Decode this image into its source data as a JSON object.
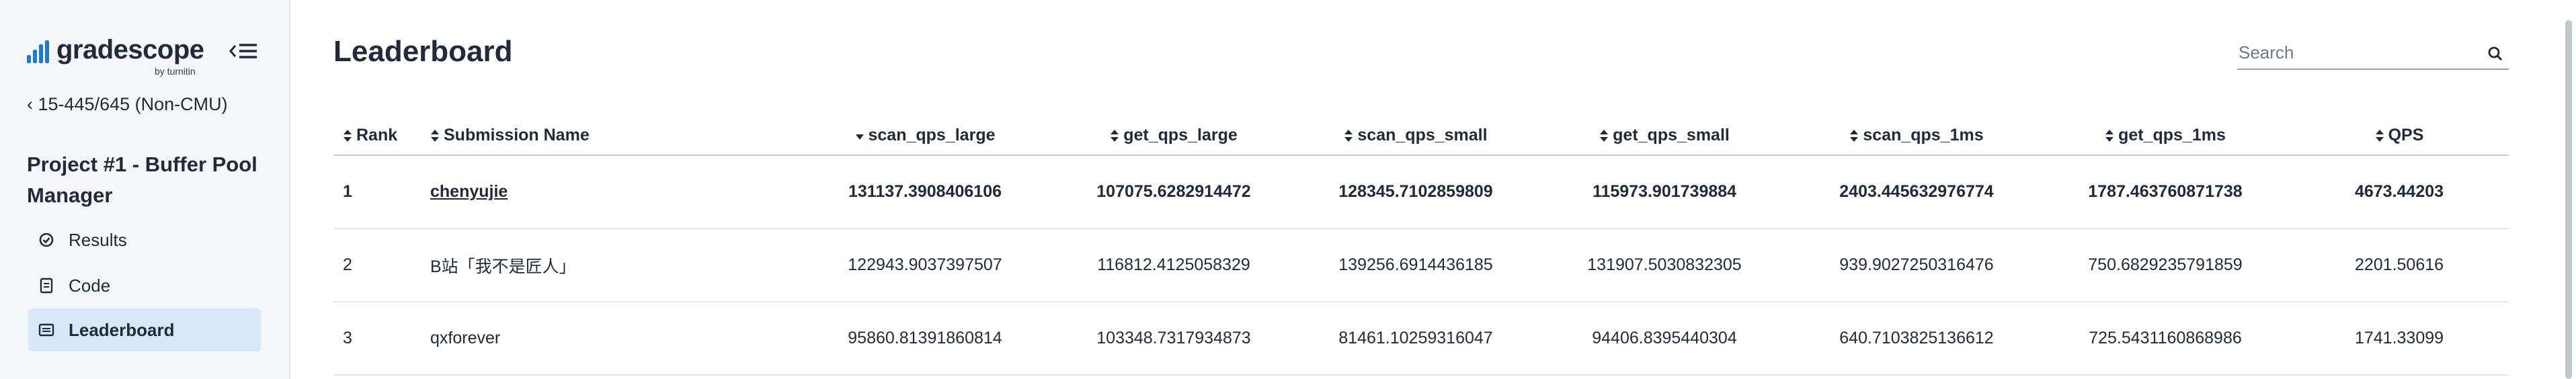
{
  "app": {
    "logo_text": "gradescope",
    "logo_sub": "by turnitin",
    "brand_color": "#1d7bd6"
  },
  "sidebar": {
    "course_link": "15-445/645 (Non-CMU)",
    "assignment_title": "Project #1 - Buffer Pool Manager",
    "items": [
      {
        "label": "Results",
        "icon": "check-circle-icon",
        "active": false
      },
      {
        "label": "Code",
        "icon": "file-code-icon",
        "active": false
      },
      {
        "label": "Leaderboard",
        "icon": "leaderboard-icon",
        "active": true
      }
    ]
  },
  "main": {
    "title": "Leaderboard",
    "search_placeholder": "Search"
  },
  "table": {
    "headers": [
      "Rank",
      "Submission Name",
      "scan_qps_large",
      "get_qps_large",
      "scan_qps_small",
      "get_qps_small",
      "scan_qps_1ms",
      "get_qps_1ms",
      "QPS"
    ],
    "sorted_column": "scan_qps_large",
    "sorted_direction": "descending",
    "rows": [
      [
        "1",
        "chenyujie",
        "131137.3908406106",
        "107075.6282914472",
        "128345.7102859809",
        "115973.901739884",
        "2403.445632976774",
        "1787.463760871738",
        "4673.44203"
      ],
      [
        "2",
        "B站「我不是匠人」",
        "122943.9037397507",
        "116812.4125058329",
        "139256.6914436185",
        "131907.5030832305",
        "939.9027250316476",
        "750.6829235791859",
        "2201.50616"
      ],
      [
        "3",
        "qxforever",
        "95860.81391860814",
        "103348.7317934873",
        "81461.10259316047",
        "94406.8395440304",
        "640.7103825136612",
        "725.5431160868986",
        "1741.33099"
      ]
    ]
  }
}
